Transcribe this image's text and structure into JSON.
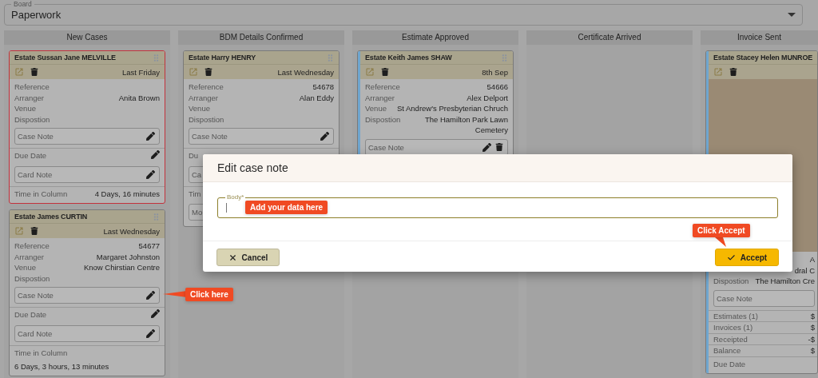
{
  "board": {
    "label": "Board",
    "value": "Paperwork"
  },
  "columns": [
    {
      "title": "New Cases",
      "cards": [
        {
          "title": "Estate Sussan Jane **MELVILLE**",
          "flagged": true,
          "date": "Last Friday",
          "items": [
            {
              "kind": "field",
              "label": "Reference"
            },
            {
              "kind": "field",
              "label": "Arranger",
              "value": "Anita Brown"
            },
            {
              "kind": "field",
              "label": "Venue"
            },
            {
              "kind": "field",
              "label": "Dispostion"
            },
            {
              "kind": "note",
              "label": "Case Note",
              "editable": true
            },
            {
              "kind": "editable",
              "label": "Due Date"
            },
            {
              "kind": "note",
              "label": "Card Note",
              "editable": true
            },
            {
              "kind": "time",
              "label": "Time in Column",
              "value": "4 Days, 16 minutes"
            }
          ]
        },
        {
          "title": "Estate James **CURTIN**",
          "flagged": false,
          "date": "Last Wednesday",
          "items": [
            {
              "kind": "field",
              "label": "Reference",
              "value": "54677"
            },
            {
              "kind": "field",
              "label": "Arranger",
              "value": "Margaret Johnston"
            },
            {
              "kind": "field",
              "label": "Venue",
              "value": "Know Chirstian Centre"
            },
            {
              "kind": "field",
              "label": "Dispostion"
            },
            {
              "kind": "note",
              "label": "Case Note",
              "editable": true
            },
            {
              "kind": "editable",
              "label": "Due Date"
            },
            {
              "kind": "note",
              "label": "Card Note",
              "editable": true
            },
            {
              "kind": "stacked",
              "label": "Time in Column",
              "value": "6 Days, 3 hours, 13 minutes"
            }
          ]
        }
      ]
    },
    {
      "title": "BDM Details Confirmed",
      "cards": [
        {
          "title": "Estate Harry **HENRY**",
          "flagged": false,
          "date": "Last Wednesday",
          "items": [
            {
              "kind": "field",
              "label": "Reference",
              "value": "54678"
            },
            {
              "kind": "field",
              "label": "Arranger",
              "value": "Alan Eddy"
            },
            {
              "kind": "field",
              "label": "Venue"
            },
            {
              "kind": "field",
              "label": "Dispostion"
            },
            {
              "kind": "note",
              "label": "Case Note",
              "editable": true
            },
            {
              "kind": "divided",
              "label": "Du"
            },
            {
              "kind": "note",
              "label": "Ca"
            },
            {
              "kind": "time",
              "label": "Tim"
            },
            {
              "kind": "note",
              "label": "Mo"
            }
          ]
        }
      ]
    },
    {
      "title": "Estimate Approved",
      "cards": [
        {
          "title": "Estate Keith James **SHAW**",
          "flagged": false,
          "color": "#6fa6cf",
          "date": "8th Sep",
          "items": [
            {
              "kind": "field",
              "label": "Reference",
              "value": "54666"
            },
            {
              "kind": "field",
              "label": "Arranger",
              "value": "Alex Delport"
            },
            {
              "kind": "field",
              "label": "Venue",
              "value": "St Andrew's Presbyterian Chruch"
            },
            {
              "kind": "field",
              "label": "Dispostion",
              "value": "The Hamilton Park Lawn Cemetery"
            },
            {
              "kind": "note",
              "label": "Case Note",
              "editable": true,
              "deletable": true
            }
          ]
        }
      ]
    },
    {
      "title": "Certificate Arrived"
    },
    {
      "title": "Invoice Sent",
      "cards": [
        {
          "title": "Estate Stacey Helen **MUNROE**",
          "flagged": false,
          "color": "#6fa6cf",
          "photo": true,
          "items": [
            {
              "kind": "field",
              "value": "A"
            },
            {
              "kind": "field",
              "value": "dral C"
            },
            {
              "kind": "field",
              "label": "Dispostion",
              "value": "The Hamilton Cre"
            },
            {
              "kind": "note",
              "label": "Case Note",
              "editable": false
            },
            {
              "kind": "ledger",
              "label": "Estimates (1)",
              "value": "$"
            },
            {
              "kind": "ledger",
              "label": "Invoices (1)",
              "value": "$"
            },
            {
              "kind": "ledger",
              "label": "Receipted",
              "value": "-$"
            },
            {
              "kind": "ledger",
              "label": "Balance",
              "value": "$"
            },
            {
              "kind": "divided",
              "label": "Due Date"
            }
          ]
        }
      ]
    }
  ],
  "dialog": {
    "title": "Edit case note",
    "field_label": "Body*",
    "buttons": [
      {
        "label": "Cancel",
        "kind": "cancel"
      },
      {
        "label": "Accept",
        "kind": "accept"
      }
    ]
  },
  "callouts": [
    {
      "text": "Add your data here",
      "kind": "plain"
    },
    {
      "text": "Click here",
      "kind": "left"
    },
    {
      "text": "Click Accept",
      "kind": "down"
    }
  ]
}
